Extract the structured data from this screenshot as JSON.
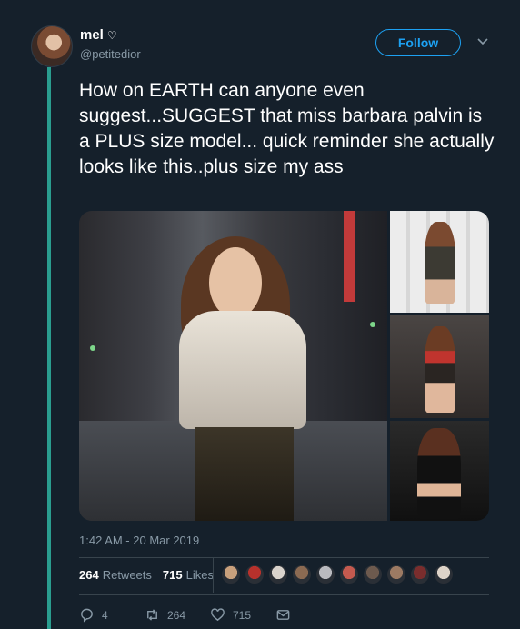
{
  "user": {
    "display_name": "mel",
    "name_emoji": "♡",
    "handle": "@petitedior"
  },
  "follow_label": "Follow",
  "tweet_text": "How on EARTH can anyone even suggest...SUGGEST that miss barbara palvin is a PLUS size model... quick reminder she actually looks like this..plus size my ass",
  "timestamp": "1:42 AM - 20 Mar 2019",
  "stats": {
    "retweets_count": "264",
    "retweets_label": "Retweets",
    "likes_count": "715",
    "likes_label": "Likes"
  },
  "actions": {
    "reply_count": "4",
    "retweet_count": "264",
    "like_count": "715"
  },
  "colors": {
    "background": "#15202b",
    "accent": "#1da1f2",
    "muted": "#8899a6",
    "thread_line": "#2a9d8f"
  },
  "liker_avatars": [
    "#c8a07c",
    "#b7312c",
    "#d9d3cc",
    "#8b6a52",
    "#b9babf",
    "#c55a4f",
    "#6d5a4e",
    "#9c7a63",
    "#7a2d2d",
    "#ddd3c8"
  ]
}
